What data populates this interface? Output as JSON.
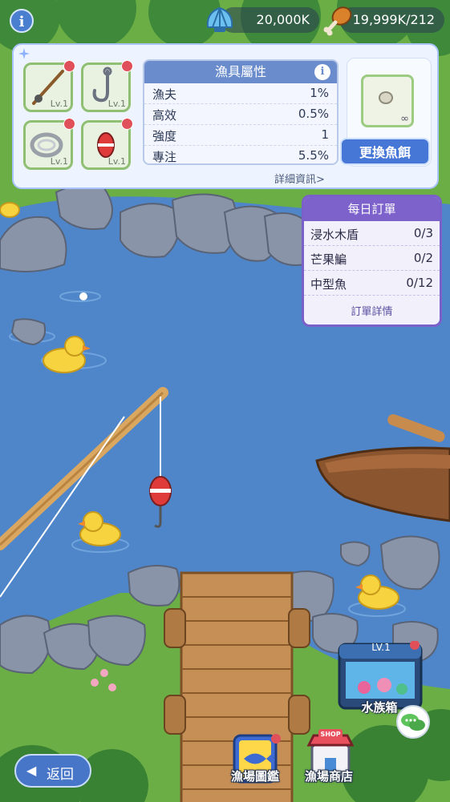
{
  "resources": {
    "shells": "20,000K",
    "food": "19,999K/212"
  },
  "gear": {
    "slots": [
      {
        "name": "fishing-rod",
        "level": "Lv.1"
      },
      {
        "name": "hook",
        "level": "Lv.1"
      },
      {
        "name": "reel",
        "level": "Lv.1"
      },
      {
        "name": "float",
        "level": "Lv.1"
      }
    ],
    "title": "漁具屬性",
    "stats": [
      {
        "key": "漁夫",
        "value": "1%"
      },
      {
        "key": "高效",
        "value": "0.5%"
      },
      {
        "key": "強度",
        "value": "1"
      },
      {
        "key": "專注",
        "value": "5.5%"
      }
    ],
    "more_link": "詳細資訊>",
    "bait_count": "∞",
    "bait_button": "更換魚餌"
  },
  "orders": {
    "title": "每日訂單",
    "items": [
      {
        "name": "浸水木盾",
        "progress": "0/3"
      },
      {
        "name": "芒果鯿",
        "progress": "0/2"
      },
      {
        "name": "中型魚",
        "progress": "0/12"
      }
    ],
    "footer": "訂單詳情"
  },
  "bottom": {
    "back": "返回",
    "guide": "漁場圖鑑",
    "shop": "漁場商店",
    "shop_sign": "SHOP",
    "aquarium_level": "LV.1",
    "aquarium": "水族箱"
  },
  "colors": {
    "water": "#4f86c9",
    "grass": "#6fb34a",
    "accent": "#4677d6",
    "order_accent": "#7d62cc"
  }
}
